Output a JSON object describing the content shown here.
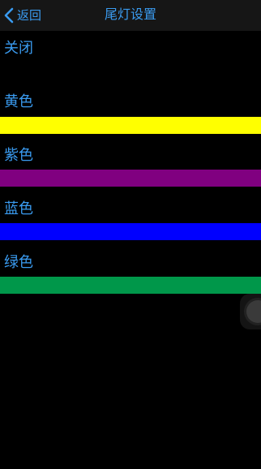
{
  "colors": {
    "accent": "#3a9bf0",
    "nav_background": "#161616",
    "nav_title": "#3a9bf0"
  },
  "navbar": {
    "back_icon": "chevron-left-icon",
    "back_label": "返回",
    "title": "尾灯设置"
  },
  "options": [
    {
      "label": "关闭",
      "swatch_color": null
    },
    {
      "label": "黄色",
      "swatch_color": "#ffff00"
    },
    {
      "label": "紫色",
      "swatch_color": "#800080"
    },
    {
      "label": "蓝色",
      "swatch_color": "#0000ff"
    },
    {
      "label": "绿色",
      "swatch_color": "#00974a"
    }
  ],
  "assistive_touch": {
    "icon": "assistive-touch-icon"
  }
}
